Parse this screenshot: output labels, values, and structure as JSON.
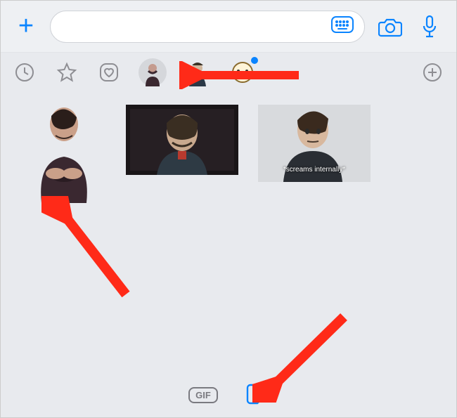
{
  "topbar": {
    "plus_label": "+",
    "input_value": "",
    "input_placeholder": ""
  },
  "pack_row": {
    "recent_label": "Recent",
    "favorites_label": "Favorites",
    "heart_label": "Love",
    "packs": [
      {
        "name": "tony-stark-pack",
        "selected": true
      },
      {
        "name": "thor-pack",
        "selected": false,
        "badge": false
      },
      {
        "name": "spiderman-pack",
        "selected": false,
        "badge": true
      }
    ]
  },
  "sticker_area": {
    "stickers": [
      {
        "name": "tony-arms-crossed",
        "caption": ""
      },
      {
        "name": "thor-ragnarok",
        "caption": ""
      },
      {
        "name": "peter-parker-screams",
        "caption": "*screams internally*"
      }
    ]
  },
  "bottom": {
    "gif_label": "GIF"
  },
  "annotations": {
    "arrow_to_pack": true,
    "arrow_to_sticker": true,
    "arrow_to_sticker_button": true
  },
  "colors": {
    "accent": "#0a84ff",
    "bg_panel": "#e8eaee",
    "arrow_red": "#ff2a18"
  }
}
